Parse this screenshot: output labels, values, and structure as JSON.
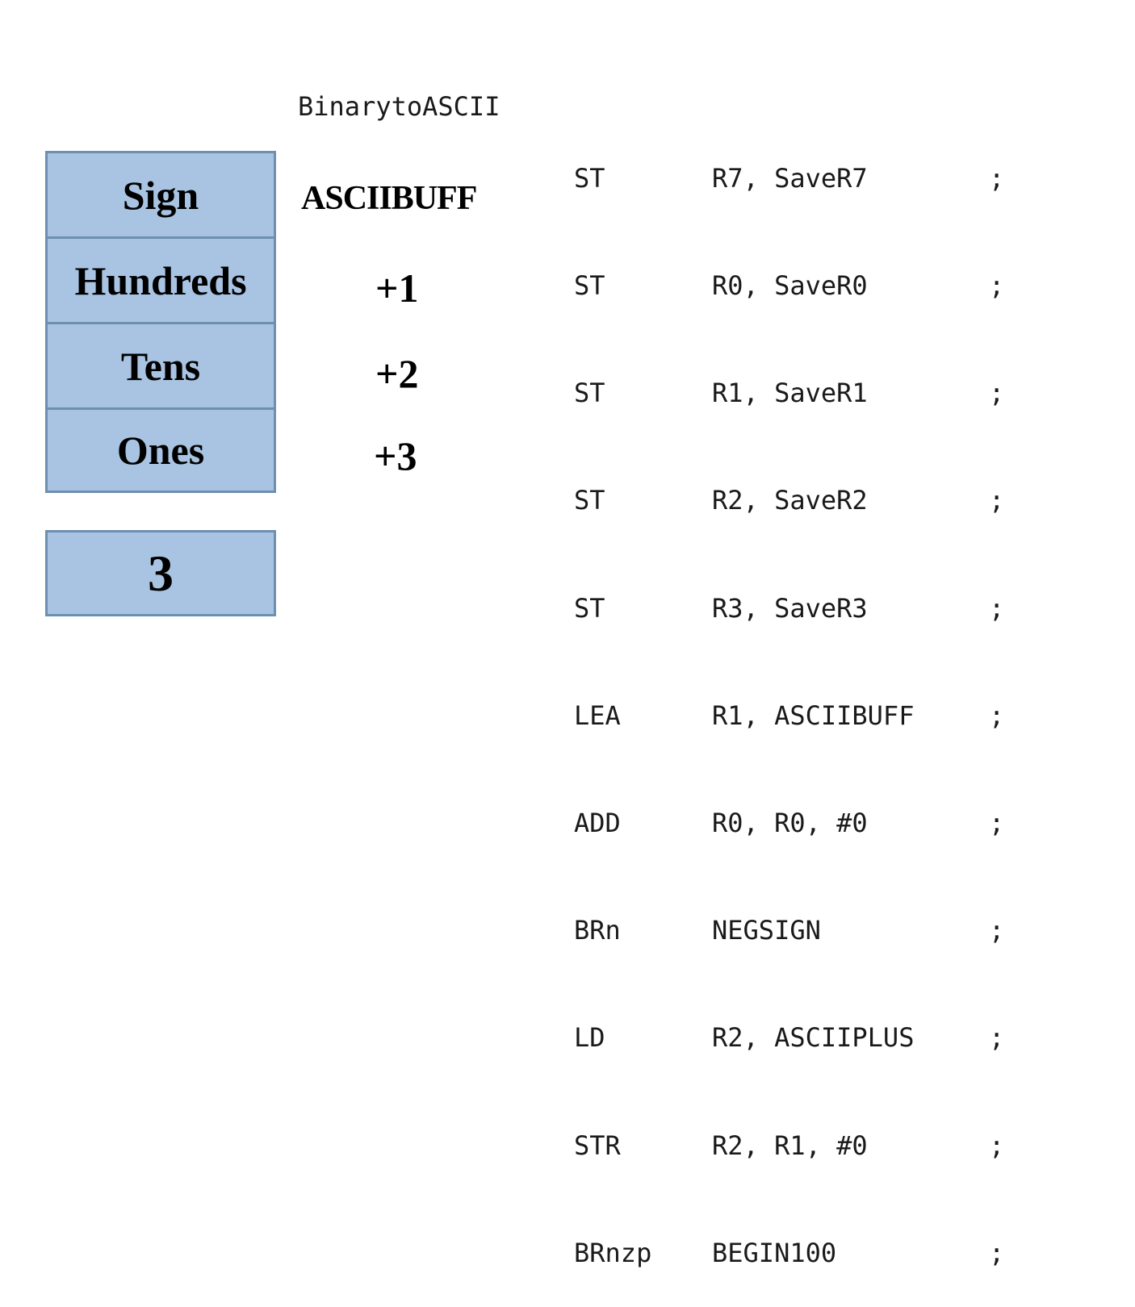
{
  "buffer": {
    "cells": [
      "Sign",
      "Hundreds",
      "Tens",
      "Ones"
    ]
  },
  "count": "3",
  "labels": {
    "buffer_name": "ASCIIBUFF",
    "offsets": [
      "+1",
      "+2",
      "+3"
    ]
  },
  "code": {
    "routine_label": "BinarytoASCII",
    "lines": [
      {
        "op": "ST",
        "args": "R7, SaveR7",
        "comment": ";"
      },
      {
        "op": "ST",
        "args": "R0, SaveR0",
        "comment": ";"
      },
      {
        "op": "ST",
        "args": "R1, SaveR1",
        "comment": ";"
      },
      {
        "op": "ST",
        "args": "R2, SaveR2",
        "comment": ";"
      },
      {
        "op": "ST",
        "args": "R3, SaveR3",
        "comment": ";"
      },
      {
        "op": "LEA",
        "args": "R1, ASCIIBUFF",
        "comment": ";"
      },
      {
        "op": "ADD",
        "args": "R0, R0, #0",
        "comment": ";"
      },
      {
        "op": "BRn",
        "args": "NEGSIGN",
        "comment": ";"
      },
      {
        "op": "LD",
        "args": "R2, ASCIIPLUS",
        "comment": ";"
      },
      {
        "op": "STR",
        "args": "R2, R1, #0",
        "comment": ";"
      },
      {
        "op": "BRnzp",
        "args": "BEGIN100",
        "comment": ";"
      }
    ]
  },
  "colors": {
    "box_fill": "#a9c4e2",
    "box_border": "#6d8fb0"
  }
}
